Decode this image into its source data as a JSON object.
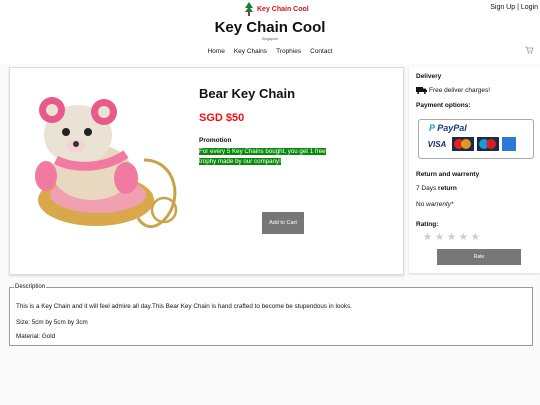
{
  "header": {
    "logo_text": "Key Chain Cool",
    "sign_up": "Sign Up",
    "separator": "|",
    "login": "Login",
    "title": "Key Chain Cool",
    "subtitle": "Singapore",
    "nav": [
      "Home",
      "Key Chains",
      "Trophies",
      "Contact"
    ],
    "cart_icon": "cart-icon",
    "logo_icon": "tree-logo-icon"
  },
  "product": {
    "name": "Bear Key Chain",
    "price": "SGD $50",
    "promotion_heading": "Promotion",
    "promotion_text": "For every 5 Key Chains bought, you get 1 free trophy made by our company!",
    "add_to_cart": "Add to Cart",
    "promo_color": "#0a8a0a",
    "price_color": "#e11111"
  },
  "side": {
    "delivery_heading": "Delivery",
    "delivery_text": "Free deliver charges!",
    "payment_heading": "Payment options:",
    "paypal_brand": "PayPal",
    "cards": [
      "VISA",
      "MasterCard",
      "Maestro",
      "AMEX"
    ],
    "return_heading": "Return and warrenty",
    "return_days": "7 Days",
    "return_word": "return",
    "warranty_no": "No",
    "warranty_word": "warrenty*",
    "rating_heading": "Rating:",
    "stars": [
      "★",
      "★",
      "★",
      "★",
      "★"
    ],
    "rate_button": "Rate"
  },
  "description": {
    "legend": "Description",
    "lines": [
      "This is a Key Chain and it will feel admire all day.This Bear Key Chain is hand crafted to become be stupendous in looks.",
      "Size: 5cm by 5cm by 3cm",
      "Material: Gold"
    ]
  }
}
